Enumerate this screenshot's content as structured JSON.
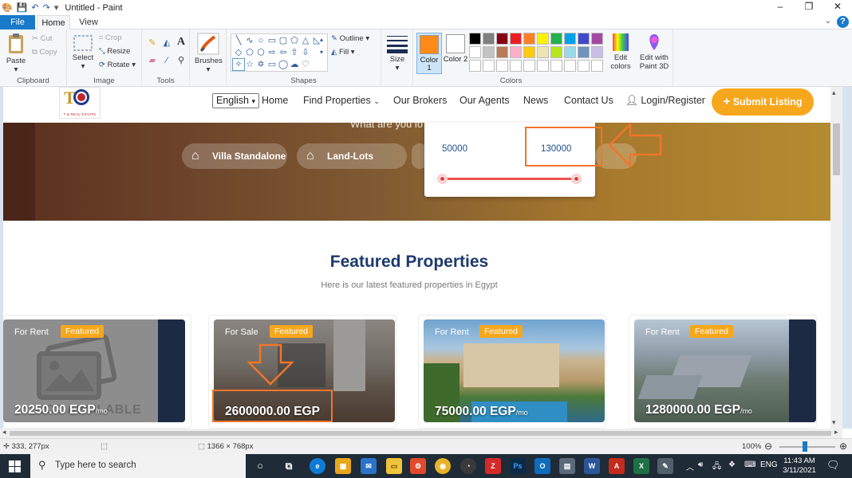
{
  "window": {
    "title": "Untitled - Paint",
    "minimize": "–",
    "restore": "❐",
    "close": "✕"
  },
  "quick_access": [
    "save-icon",
    "undo-icon",
    "redo-icon",
    "customize-icon"
  ],
  "tabs": [
    "File",
    "Home",
    "View"
  ],
  "ribbon": {
    "clipboard": {
      "paste": "Paste",
      "cut": "Cut",
      "copy": "Copy",
      "label": "Clipboard"
    },
    "image": {
      "select": "Select",
      "crop": "Crop",
      "resize": "Resize",
      "rotate": "Rotate",
      "label": "Image"
    },
    "tools": {
      "label": "Tools"
    },
    "brushes": {
      "label": "Brushes"
    },
    "shapes": {
      "outline": "Outline",
      "fill": "Fill",
      "label": "Shapes"
    },
    "size": {
      "label": "Size"
    },
    "colors": {
      "color1": "Color 1",
      "color2": "Color 2",
      "color1_value": "#ff8a17",
      "color2_value": "#ffffff",
      "edit_colors": "Edit colors",
      "edit_3d": "Edit with Paint 3D",
      "label": "Colors",
      "palette_row1": [
        "#000000",
        "#7f7f7f",
        "#880015",
        "#ed1c24",
        "#ff7f27",
        "#fff200",
        "#22b14c",
        "#00a2e8",
        "#3f48cc",
        "#a349a4"
      ],
      "palette_row2": [
        "#ffffff",
        "#c3c3c3",
        "#b97a57",
        "#ffaec9",
        "#ffc90e",
        "#efe4b0",
        "#b5e61d",
        "#99d9ea",
        "#7092be",
        "#c8bfe7"
      ]
    }
  },
  "webpage": {
    "nav": {
      "language": "English",
      "links": [
        "Home",
        "Find Properties",
        "Our Brokers",
        "Our Agents",
        "News",
        "Contact Us"
      ],
      "login": "Login/Register",
      "submit": "Submit Listing",
      "logo_sub": "T & REAL ESTATE"
    },
    "hero": {
      "text": "What are you lo",
      "chips": [
        "Villa Standalone",
        "Land-Lots"
      ]
    },
    "price_range": {
      "min": "50000",
      "max": "130000"
    },
    "featured": {
      "title": "Featured Properties",
      "subtitle": "Here is our latest featured properties in Egypt"
    },
    "cards": [
      {
        "type": "For Rent",
        "badge": "Featured",
        "price": "20250.00 EGP",
        "unit": "/mo",
        "overlay": "NOT AVAILABLE"
      },
      {
        "type": "For Sale",
        "badge": "Featured",
        "price": "2600000.00 EGP",
        "unit": ""
      },
      {
        "type": "For Rent",
        "badge": "Featured",
        "price": "75000.00 EGP",
        "unit": "/mo"
      },
      {
        "type": "For Rent",
        "badge": "Featured",
        "price": "1280000.00 EGP",
        "unit": "/mo"
      }
    ]
  },
  "status": {
    "cursor": "333, 277px",
    "size": "1366 × 768px",
    "zoom": "100%",
    "zoom_level": 1.0
  },
  "taskbar": {
    "search": "Type here to search",
    "lang": "ENG",
    "time": "11:43 AM",
    "date": "3/11/2021"
  }
}
